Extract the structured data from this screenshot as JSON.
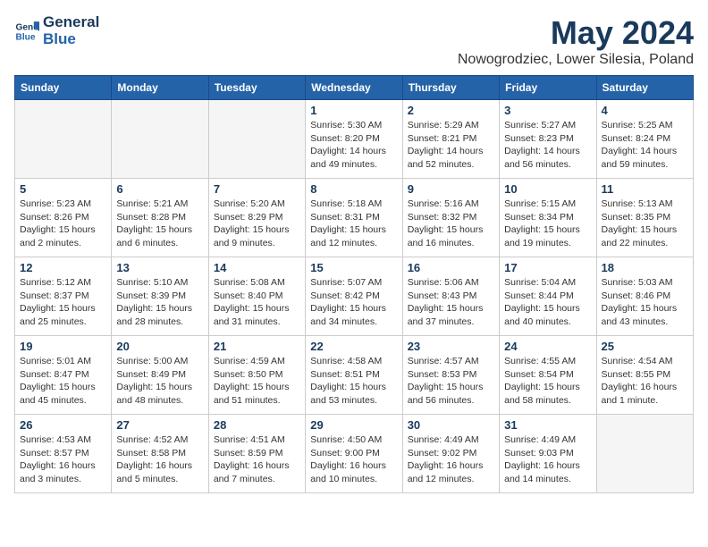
{
  "header": {
    "logo_line1": "General",
    "logo_line2": "Blue",
    "month_year": "May 2024",
    "location": "Nowogrodziec, Lower Silesia, Poland"
  },
  "weekdays": [
    "Sunday",
    "Monday",
    "Tuesday",
    "Wednesday",
    "Thursday",
    "Friday",
    "Saturday"
  ],
  "weeks": [
    [
      {
        "day": "",
        "info": ""
      },
      {
        "day": "",
        "info": ""
      },
      {
        "day": "",
        "info": ""
      },
      {
        "day": "1",
        "info": "Sunrise: 5:30 AM\nSunset: 8:20 PM\nDaylight: 14 hours\nand 49 minutes."
      },
      {
        "day": "2",
        "info": "Sunrise: 5:29 AM\nSunset: 8:21 PM\nDaylight: 14 hours\nand 52 minutes."
      },
      {
        "day": "3",
        "info": "Sunrise: 5:27 AM\nSunset: 8:23 PM\nDaylight: 14 hours\nand 56 minutes."
      },
      {
        "day": "4",
        "info": "Sunrise: 5:25 AM\nSunset: 8:24 PM\nDaylight: 14 hours\nand 59 minutes."
      }
    ],
    [
      {
        "day": "5",
        "info": "Sunrise: 5:23 AM\nSunset: 8:26 PM\nDaylight: 15 hours\nand 2 minutes."
      },
      {
        "day": "6",
        "info": "Sunrise: 5:21 AM\nSunset: 8:28 PM\nDaylight: 15 hours\nand 6 minutes."
      },
      {
        "day": "7",
        "info": "Sunrise: 5:20 AM\nSunset: 8:29 PM\nDaylight: 15 hours\nand 9 minutes."
      },
      {
        "day": "8",
        "info": "Sunrise: 5:18 AM\nSunset: 8:31 PM\nDaylight: 15 hours\nand 12 minutes."
      },
      {
        "day": "9",
        "info": "Sunrise: 5:16 AM\nSunset: 8:32 PM\nDaylight: 15 hours\nand 16 minutes."
      },
      {
        "day": "10",
        "info": "Sunrise: 5:15 AM\nSunset: 8:34 PM\nDaylight: 15 hours\nand 19 minutes."
      },
      {
        "day": "11",
        "info": "Sunrise: 5:13 AM\nSunset: 8:35 PM\nDaylight: 15 hours\nand 22 minutes."
      }
    ],
    [
      {
        "day": "12",
        "info": "Sunrise: 5:12 AM\nSunset: 8:37 PM\nDaylight: 15 hours\nand 25 minutes."
      },
      {
        "day": "13",
        "info": "Sunrise: 5:10 AM\nSunset: 8:39 PM\nDaylight: 15 hours\nand 28 minutes."
      },
      {
        "day": "14",
        "info": "Sunrise: 5:08 AM\nSunset: 8:40 PM\nDaylight: 15 hours\nand 31 minutes."
      },
      {
        "day": "15",
        "info": "Sunrise: 5:07 AM\nSunset: 8:42 PM\nDaylight: 15 hours\nand 34 minutes."
      },
      {
        "day": "16",
        "info": "Sunrise: 5:06 AM\nSunset: 8:43 PM\nDaylight: 15 hours\nand 37 minutes."
      },
      {
        "day": "17",
        "info": "Sunrise: 5:04 AM\nSunset: 8:44 PM\nDaylight: 15 hours\nand 40 minutes."
      },
      {
        "day": "18",
        "info": "Sunrise: 5:03 AM\nSunset: 8:46 PM\nDaylight: 15 hours\nand 43 minutes."
      }
    ],
    [
      {
        "day": "19",
        "info": "Sunrise: 5:01 AM\nSunset: 8:47 PM\nDaylight: 15 hours\nand 45 minutes."
      },
      {
        "day": "20",
        "info": "Sunrise: 5:00 AM\nSunset: 8:49 PM\nDaylight: 15 hours\nand 48 minutes."
      },
      {
        "day": "21",
        "info": "Sunrise: 4:59 AM\nSunset: 8:50 PM\nDaylight: 15 hours\nand 51 minutes."
      },
      {
        "day": "22",
        "info": "Sunrise: 4:58 AM\nSunset: 8:51 PM\nDaylight: 15 hours\nand 53 minutes."
      },
      {
        "day": "23",
        "info": "Sunrise: 4:57 AM\nSunset: 8:53 PM\nDaylight: 15 hours\nand 56 minutes."
      },
      {
        "day": "24",
        "info": "Sunrise: 4:55 AM\nSunset: 8:54 PM\nDaylight: 15 hours\nand 58 minutes."
      },
      {
        "day": "25",
        "info": "Sunrise: 4:54 AM\nSunset: 8:55 PM\nDaylight: 16 hours\nand 1 minute."
      }
    ],
    [
      {
        "day": "26",
        "info": "Sunrise: 4:53 AM\nSunset: 8:57 PM\nDaylight: 16 hours\nand 3 minutes."
      },
      {
        "day": "27",
        "info": "Sunrise: 4:52 AM\nSunset: 8:58 PM\nDaylight: 16 hours\nand 5 minutes."
      },
      {
        "day": "28",
        "info": "Sunrise: 4:51 AM\nSunset: 8:59 PM\nDaylight: 16 hours\nand 7 minutes."
      },
      {
        "day": "29",
        "info": "Sunrise: 4:50 AM\nSunset: 9:00 PM\nDaylight: 16 hours\nand 10 minutes."
      },
      {
        "day": "30",
        "info": "Sunrise: 4:49 AM\nSunset: 9:02 PM\nDaylight: 16 hours\nand 12 minutes."
      },
      {
        "day": "31",
        "info": "Sunrise: 4:49 AM\nSunset: 9:03 PM\nDaylight: 16 hours\nand 14 minutes."
      },
      {
        "day": "",
        "info": ""
      }
    ]
  ]
}
